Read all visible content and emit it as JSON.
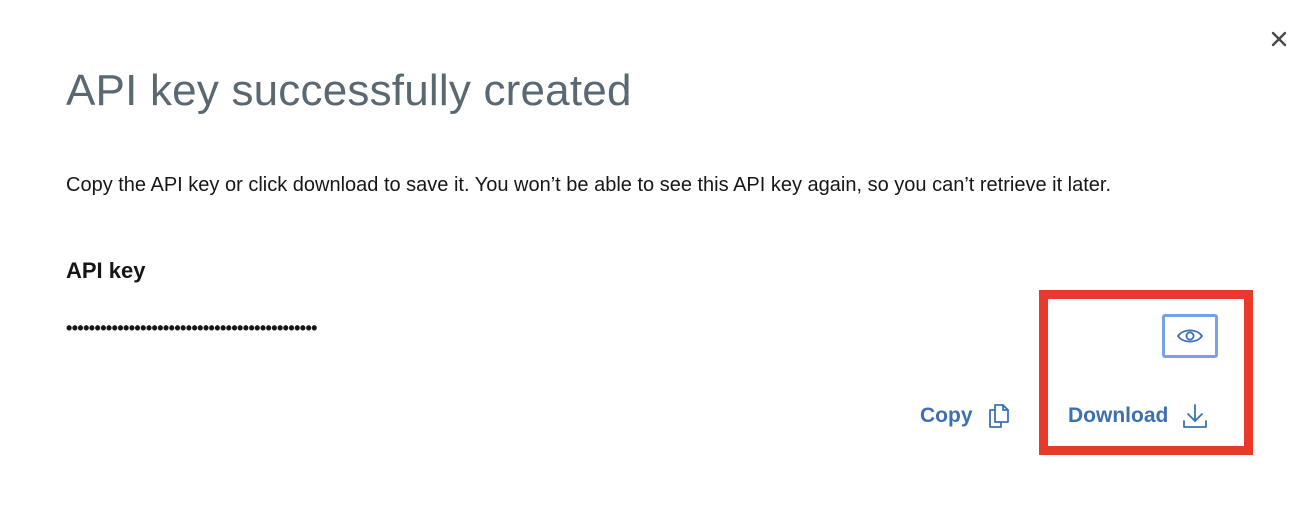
{
  "dialog": {
    "title": "API key successfully created",
    "description": "Copy the API key or click download to save it. You won’t be able to see this API key again, so you can’t retrieve it later.",
    "close_icon": "close-icon"
  },
  "api_key": {
    "label": "API key",
    "masked_value": "••••••••••••••••••••••••••••••••••••••••••••",
    "visibility_icon": "eye-icon"
  },
  "actions": {
    "copy_label": "Copy",
    "copy_icon": "copy-icon",
    "download_label": "Download",
    "download_icon": "download-icon"
  },
  "colors": {
    "link": "#3d70b2",
    "title": "#5a6872",
    "highlight": "#e8392a",
    "focus_ring": "#7aa1e8"
  }
}
